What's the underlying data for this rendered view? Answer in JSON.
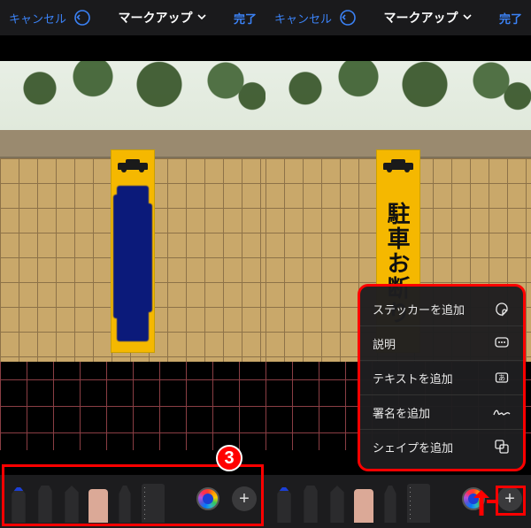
{
  "topbar": {
    "cancel": "キャンセル",
    "title": "マークアップ",
    "done": "完了"
  },
  "sign": {
    "text": "駐車お断り"
  },
  "badge": "3",
  "colors": {
    "accent": "#3b82f6",
    "selected_tool_color": "#1b3fd6",
    "annotation": "#ff0000"
  },
  "popup": {
    "items": [
      {
        "label": "ステッカーを追加",
        "icon": "sticker"
      },
      {
        "label": "説明",
        "icon": "speech"
      },
      {
        "label": "テキストを追加",
        "icon": "textbox"
      },
      {
        "label": "署名を追加",
        "icon": "signature"
      },
      {
        "label": "シェイプを追加",
        "icon": "shapes"
      }
    ]
  },
  "tools": [
    "pen",
    "marker",
    "pencil",
    "eraser",
    "cut",
    "ruler"
  ]
}
